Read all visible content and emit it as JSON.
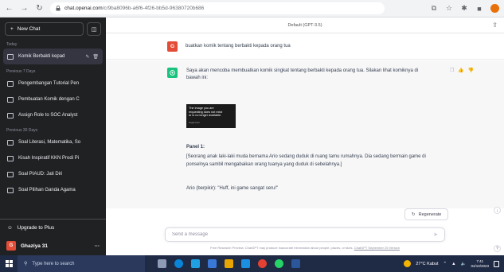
{
  "browser": {
    "url_host": "chat.openai.com",
    "url_path": "/c/9ba8096b-a6f6-4f26-bb5d-96380720b686"
  },
  "sidebar": {
    "new_chat_label": "New Chat",
    "sections": [
      {
        "title": "Today",
        "items": [
          {
            "label": "Komik Berbakti kepad",
            "active": true
          }
        ]
      },
      {
        "title": "Previous 7 Days",
        "items": [
          {
            "label": "Pengembangan Tutorial Pen",
            "active": false
          },
          {
            "label": "Pembuatan Komik dengan C",
            "active": false
          },
          {
            "label": "Assign Role to SOC Analyst",
            "active": false
          }
        ]
      },
      {
        "title": "Previous 30 Days",
        "items": [
          {
            "label": "Soal Literasi, Matematika, So",
            "active": false
          },
          {
            "label": "Kisah Inspiratif KKN Prodi Pi",
            "active": false
          },
          {
            "label": "Soal PIAUD: Jati Diri",
            "active": false
          },
          {
            "label": "Soal Pilihan Ganda Agama",
            "active": false
          }
        ]
      }
    ],
    "upgrade_label": "Upgrade to Plus",
    "user_initial": "G",
    "user_name": "Ghaziya 31"
  },
  "main": {
    "model_label": "Default (GPT-3.5)",
    "user_initial": "G",
    "user_message": "buatkan komik tentang berbakti kepada orang tua",
    "bot_intro": "Saya akan mencoba membuatkan komik singkat tentang berbakti kepada orang tua. Silakan lihat komiknya di bawah ini:",
    "image_error": {
      "line1": "The image you are",
      "line2": "requesting does not exist",
      "line3": "or is no longer available.",
      "source": "imgur.com"
    },
    "panel_title": "Panel 1:",
    "panel_text": "[Seorang anak laki-laki muda bernama Ario sedang duduk di ruang tamu rumahnya. Dia sedang bermain game di ponselnya sambil mengabaikan orang tuanya yang duduk di sebelahnya.]",
    "dialog": "Ario (berpikir): \"Huff, ini game sangat seru!\"",
    "regenerate_label": "Regenerate",
    "input_placeholder": "Send a message",
    "footer_text": "Free Research Preview. ChatGPT may produce inaccurate information about people, places, or facts.",
    "footer_link": "ChatGPT September 25 Version"
  },
  "taskbar": {
    "search_placeholder": "Type here to search",
    "weather": "27°C Kabut",
    "time": "7:41",
    "date": "04/10/2023"
  }
}
